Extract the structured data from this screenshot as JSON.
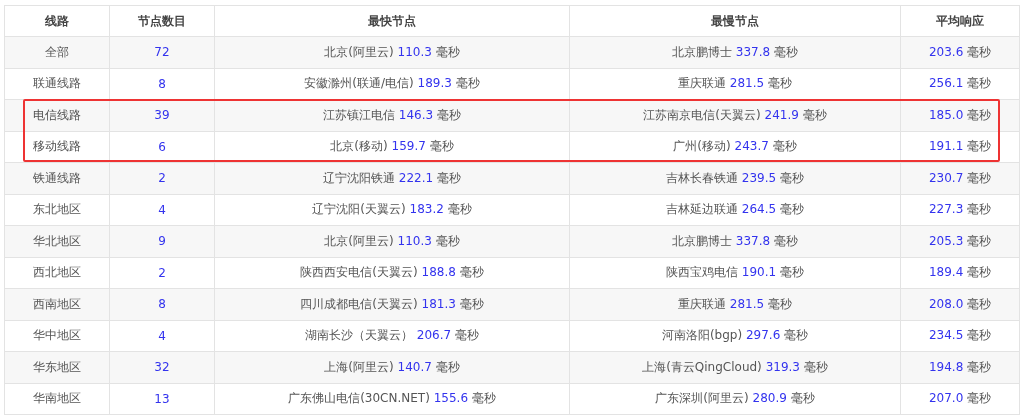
{
  "table": {
    "columns": [
      "线路",
      "节点数目",
      "最快节点",
      "最慢节点",
      "平均响应"
    ],
    "rows": [
      {
        "line": "全部",
        "count": "72",
        "fastest": {
          "node": "北京(阿里云)",
          "value": "110.3",
          "unit": "毫秒"
        },
        "slowest": {
          "node": "北京鹏博士",
          "value": "337.8",
          "unit": "毫秒"
        },
        "average": {
          "value": "203.6",
          "unit": "毫秒"
        },
        "highlighted": false
      },
      {
        "line": "联通线路",
        "count": "8",
        "fastest": {
          "node": "安徽滁州(联通/电信)",
          "value": "189.3",
          "unit": "毫秒"
        },
        "slowest": {
          "node": "重庆联通",
          "value": "281.5",
          "unit": "毫秒"
        },
        "average": {
          "value": "256.1",
          "unit": "毫秒"
        },
        "highlighted": false
      },
      {
        "line": "电信线路",
        "count": "39",
        "fastest": {
          "node": "江苏镇江电信",
          "value": "146.3",
          "unit": "毫秒"
        },
        "slowest": {
          "node": "江苏南京电信(天翼云)",
          "value": "241.9",
          "unit": "毫秒"
        },
        "average": {
          "value": "185.0",
          "unit": "毫秒"
        },
        "highlighted": true
      },
      {
        "line": "移动线路",
        "count": "6",
        "fastest": {
          "node": "北京(移动)",
          "value": "159.7",
          "unit": "毫秒"
        },
        "slowest": {
          "node": "广州(移动)",
          "value": "243.7",
          "unit": "毫秒"
        },
        "average": {
          "value": "191.1",
          "unit": "毫秒"
        },
        "highlighted": true
      },
      {
        "line": "铁通线路",
        "count": "2",
        "fastest": {
          "node": "辽宁沈阳铁通",
          "value": "222.1",
          "unit": "毫秒"
        },
        "slowest": {
          "node": "吉林长春铁通",
          "value": "239.5",
          "unit": "毫秒"
        },
        "average": {
          "value": "230.7",
          "unit": "毫秒"
        },
        "highlighted": false
      },
      {
        "line": "东北地区",
        "count": "4",
        "fastest": {
          "node": "辽宁沈阳(天翼云)",
          "value": "183.2",
          "unit": "毫秒"
        },
        "slowest": {
          "node": "吉林延边联通",
          "value": "264.5",
          "unit": "毫秒"
        },
        "average": {
          "value": "227.3",
          "unit": "毫秒"
        },
        "highlighted": false
      },
      {
        "line": "华北地区",
        "count": "9",
        "fastest": {
          "node": "北京(阿里云)",
          "value": "110.3",
          "unit": "毫秒"
        },
        "slowest": {
          "node": "北京鹏博士",
          "value": "337.8",
          "unit": "毫秒"
        },
        "average": {
          "value": "205.3",
          "unit": "毫秒"
        },
        "highlighted": false
      },
      {
        "line": "西北地区",
        "count": "2",
        "fastest": {
          "node": "陕西西安电信(天翼云)",
          "value": "188.8",
          "unit": "毫秒"
        },
        "slowest": {
          "node": "陕西宝鸡电信",
          "value": "190.1",
          "unit": "毫秒"
        },
        "average": {
          "value": "189.4",
          "unit": "毫秒"
        },
        "highlighted": false
      },
      {
        "line": "西南地区",
        "count": "8",
        "fastest": {
          "node": "四川成都电信(天翼云)",
          "value": "181.3",
          "unit": "毫秒"
        },
        "slowest": {
          "node": "重庆联通",
          "value": "281.5",
          "unit": "毫秒"
        },
        "average": {
          "value": "208.0",
          "unit": "毫秒"
        },
        "highlighted": false
      },
      {
        "line": "华中地区",
        "count": "4",
        "fastest": {
          "node": "湖南长沙（天翼云）",
          "value": "206.7",
          "unit": "毫秒"
        },
        "slowest": {
          "node": "河南洛阳(bgp)",
          "value": "297.6",
          "unit": "毫秒"
        },
        "average": {
          "value": "234.5",
          "unit": "毫秒"
        },
        "highlighted": false
      },
      {
        "line": "华东地区",
        "count": "32",
        "fastest": {
          "node": "上海(阿里云)",
          "value": "140.7",
          "unit": "毫秒"
        },
        "slowest": {
          "node": "上海(青云QingCloud)",
          "value": "319.3",
          "unit": "毫秒"
        },
        "average": {
          "value": "194.8",
          "unit": "毫秒"
        },
        "highlighted": false
      },
      {
        "line": "华南地区",
        "count": "13",
        "fastest": {
          "node": "广东佛山电信(30CN.NET)",
          "value": "155.6",
          "unit": "毫秒"
        },
        "slowest": {
          "node": "广东深圳(阿里云)",
          "value": "280.9",
          "unit": "毫秒"
        },
        "average": {
          "value": "207.0",
          "unit": "毫秒"
        },
        "highlighted": false
      }
    ]
  }
}
